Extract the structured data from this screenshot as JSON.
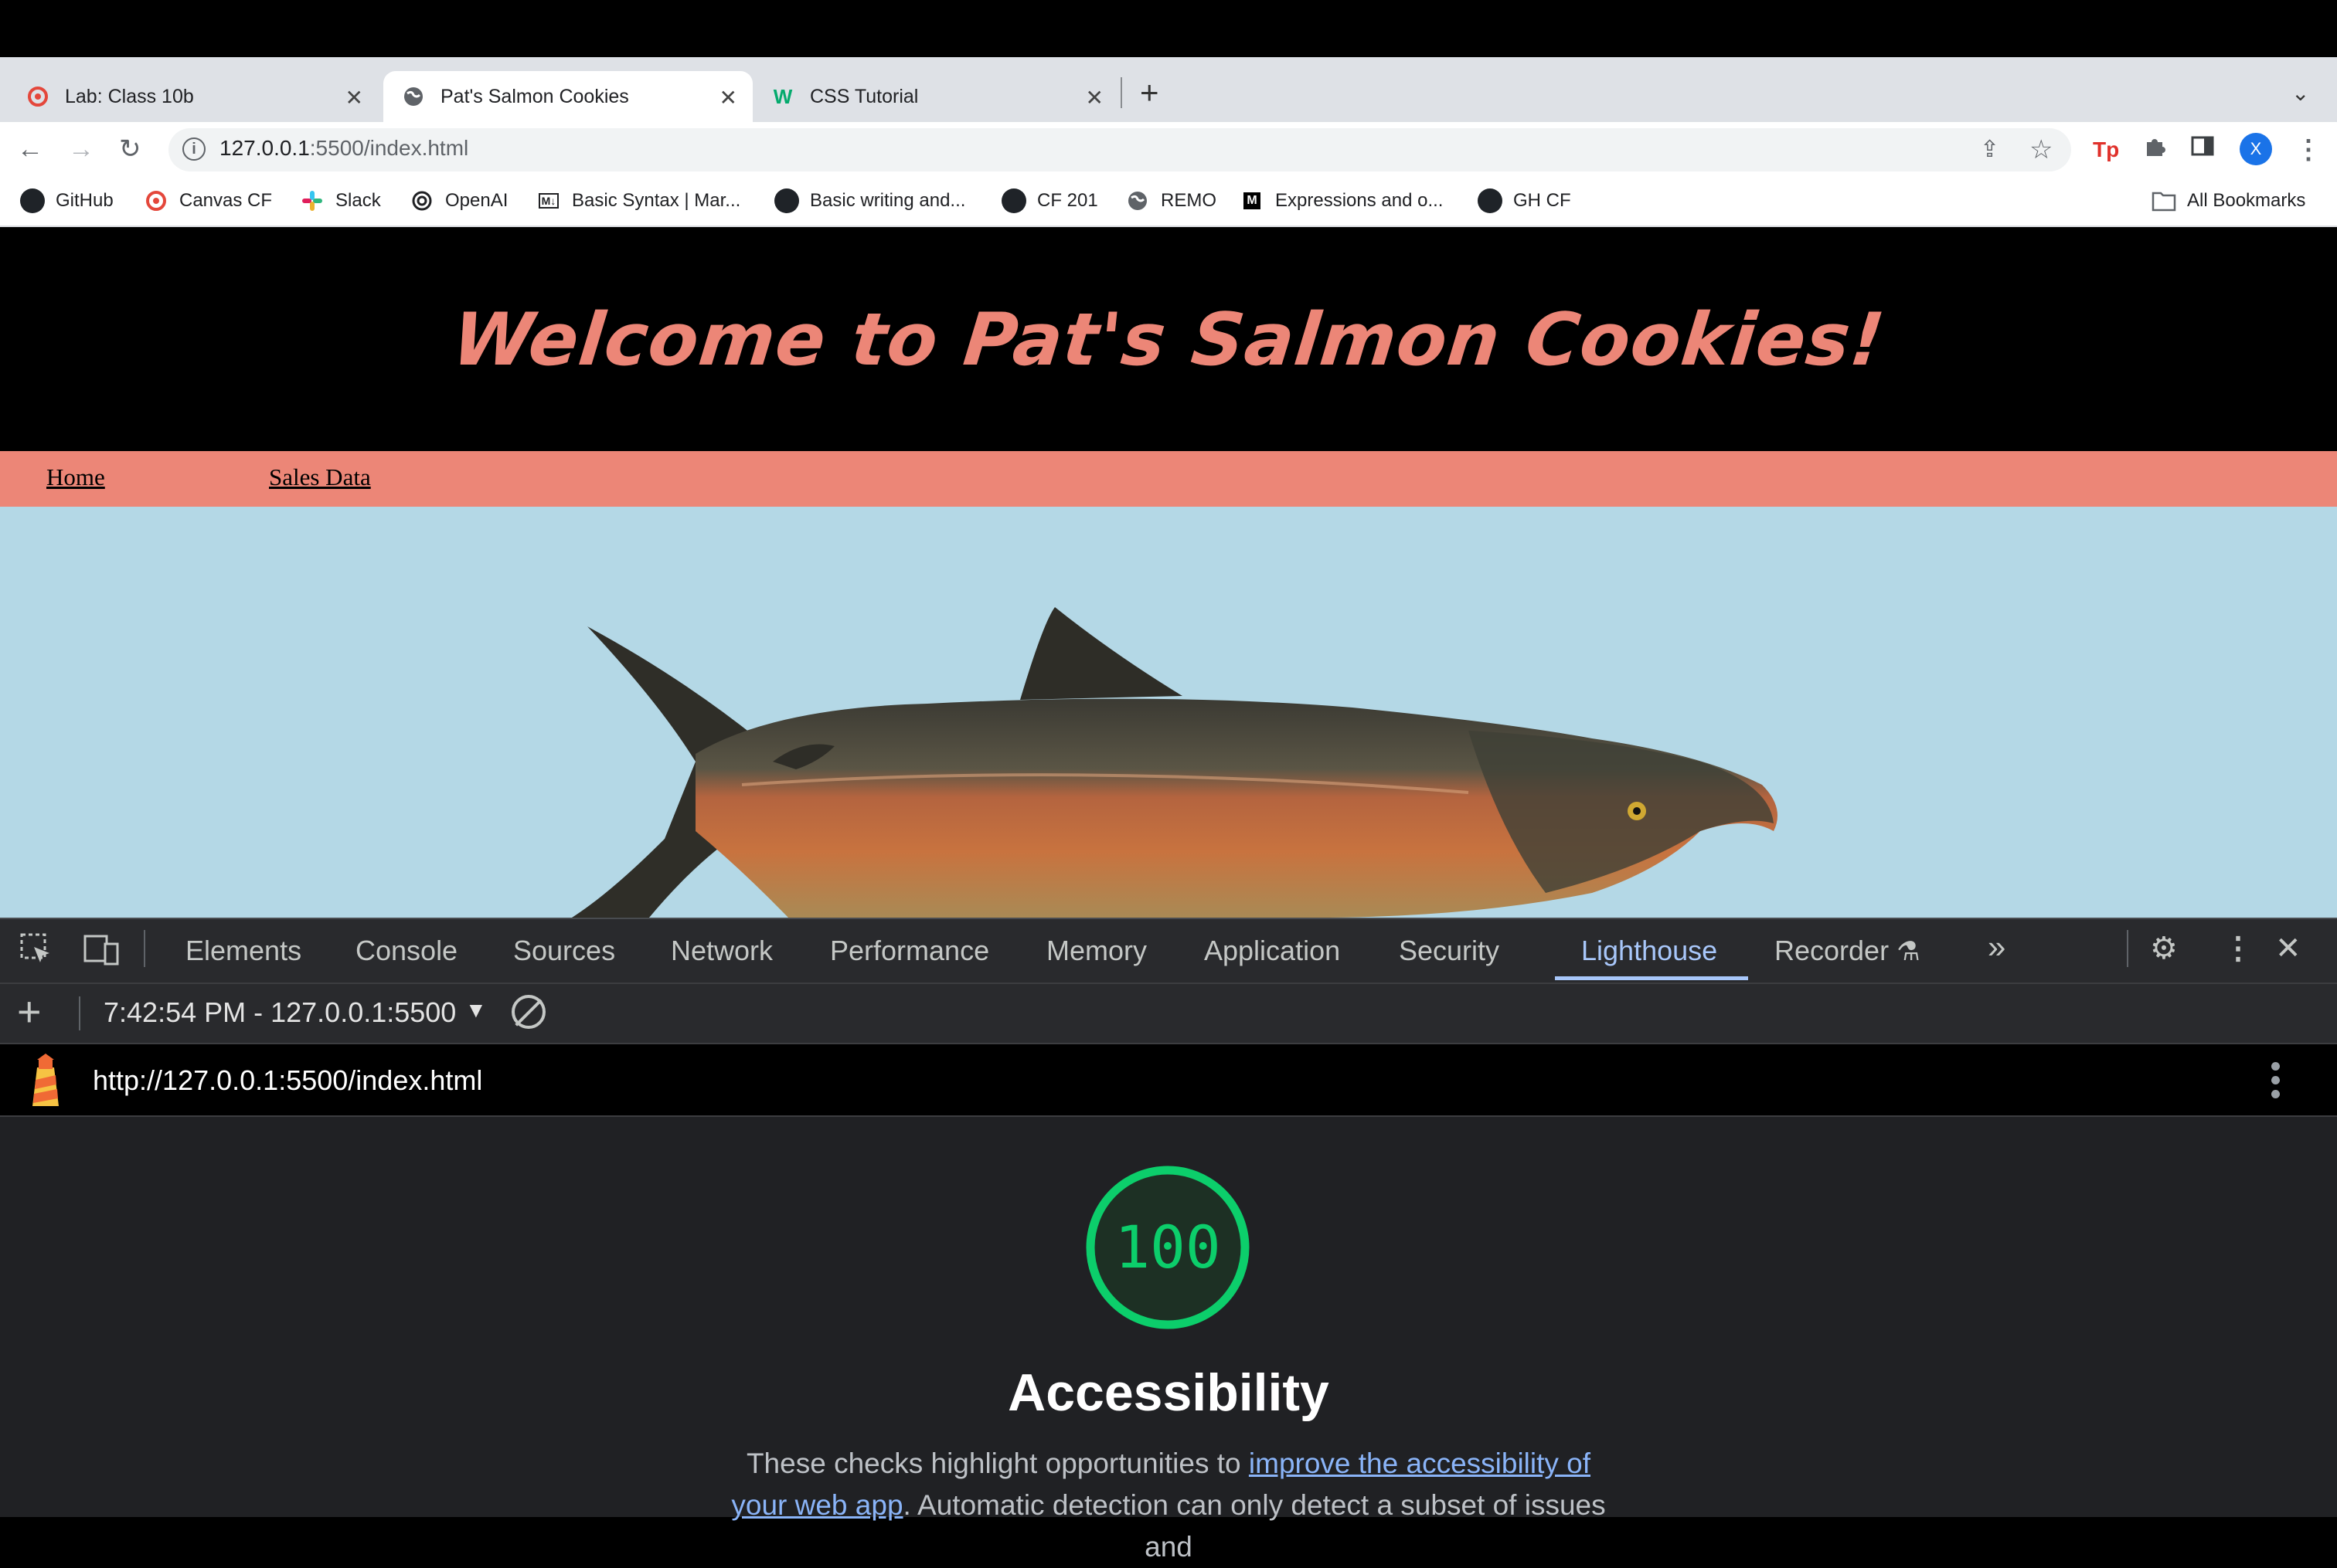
{
  "browser": {
    "tabs": [
      {
        "title": "Lab: Class 10b",
        "icon": "canvas-icon",
        "active": false
      },
      {
        "title": "Pat's Salmon Cookies",
        "icon": "globe-icon",
        "active": true
      },
      {
        "title": "CSS Tutorial",
        "icon": "w3schools-icon",
        "active": false
      }
    ],
    "new_tab": "+",
    "address": {
      "host": "127.0.0.1",
      "rest": ":5500/index.html"
    },
    "avatar_letter": "X",
    "bookmarks": [
      {
        "label": "GitHub",
        "icon": "github-icon"
      },
      {
        "label": "Canvas CF",
        "icon": "canvas-icon"
      },
      {
        "label": "Slack",
        "icon": "slack-icon"
      },
      {
        "label": "OpenAI",
        "icon": "openai-icon"
      },
      {
        "label": "Basic Syntax | Mar...",
        "icon": "markdown-icon"
      },
      {
        "label": "Basic writing and...",
        "icon": "github-icon"
      },
      {
        "label": "CF 201",
        "icon": "github-icon"
      },
      {
        "label": "REMO",
        "icon": "globe-icon"
      },
      {
        "label": "Expressions and o...",
        "icon": "mdn-icon"
      },
      {
        "label": "GH CF",
        "icon": "github-icon"
      }
    ],
    "all_bookmarks": "All Bookmarks"
  },
  "site": {
    "title": "Welcome to Pat's Salmon Cookies!",
    "nav": [
      "Home",
      "Sales Data"
    ]
  },
  "devtools": {
    "tabs": [
      "Elements",
      "Console",
      "Sources",
      "Network",
      "Performance",
      "Memory",
      "Application",
      "Security",
      "Lighthouse",
      "Recorder"
    ],
    "active_tab": "Lighthouse",
    "more": "»",
    "report_label": "7:42:54 PM - 127.0.0.1:5500",
    "url": "http://127.0.0.1:5500/index.html",
    "score": "100",
    "score_color": "#0cce6b",
    "category": "Accessibility",
    "desc_before": "These checks highlight opportunities to ",
    "desc_link": "improve the accessibility of your web app",
    "desc_after": ". Automatic detection can only detect a subset of issues and"
  }
}
